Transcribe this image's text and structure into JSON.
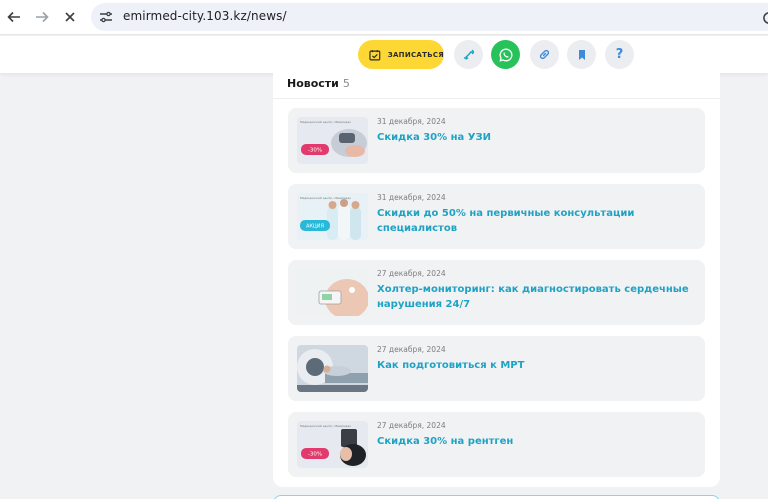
{
  "browser": {
    "url": "emirmed-city.103.kz/news/"
  },
  "toolbar": {
    "book_label": "ЗАПИСАТЬСЯ",
    "help_label": "?",
    "accent": "#fdd835",
    "whatsapp_color": "#27c25a"
  },
  "news": {
    "title": "Новости",
    "count": "5",
    "items": [
      {
        "date": "31 декабря, 2024",
        "title": "Скидка 30% на УЗИ",
        "thumb_caption": "Медицинский центр «Эмирмед»",
        "badge": "-30%"
      },
      {
        "date": "31 декабря, 2024",
        "title": "Скидки до 50% на первичные консультации специалистов",
        "thumb_caption": "Медицинский центр «Эмирмед»",
        "badge": "АКЦИЯ"
      },
      {
        "date": "27 декабря, 2024",
        "title": "Холтер-мониторинг: как диагностировать сердечные нарушения 24/7"
      },
      {
        "date": "27 декабря, 2024",
        "title": "Как подготовиться к МРТ"
      },
      {
        "date": "27 декабря, 2024",
        "title": "Скидка 30% на рентген",
        "thumb_caption": "Медицинский центр «Эмирмед»",
        "badge": "-30%"
      }
    ],
    "link_color": "#1fa3c5"
  }
}
